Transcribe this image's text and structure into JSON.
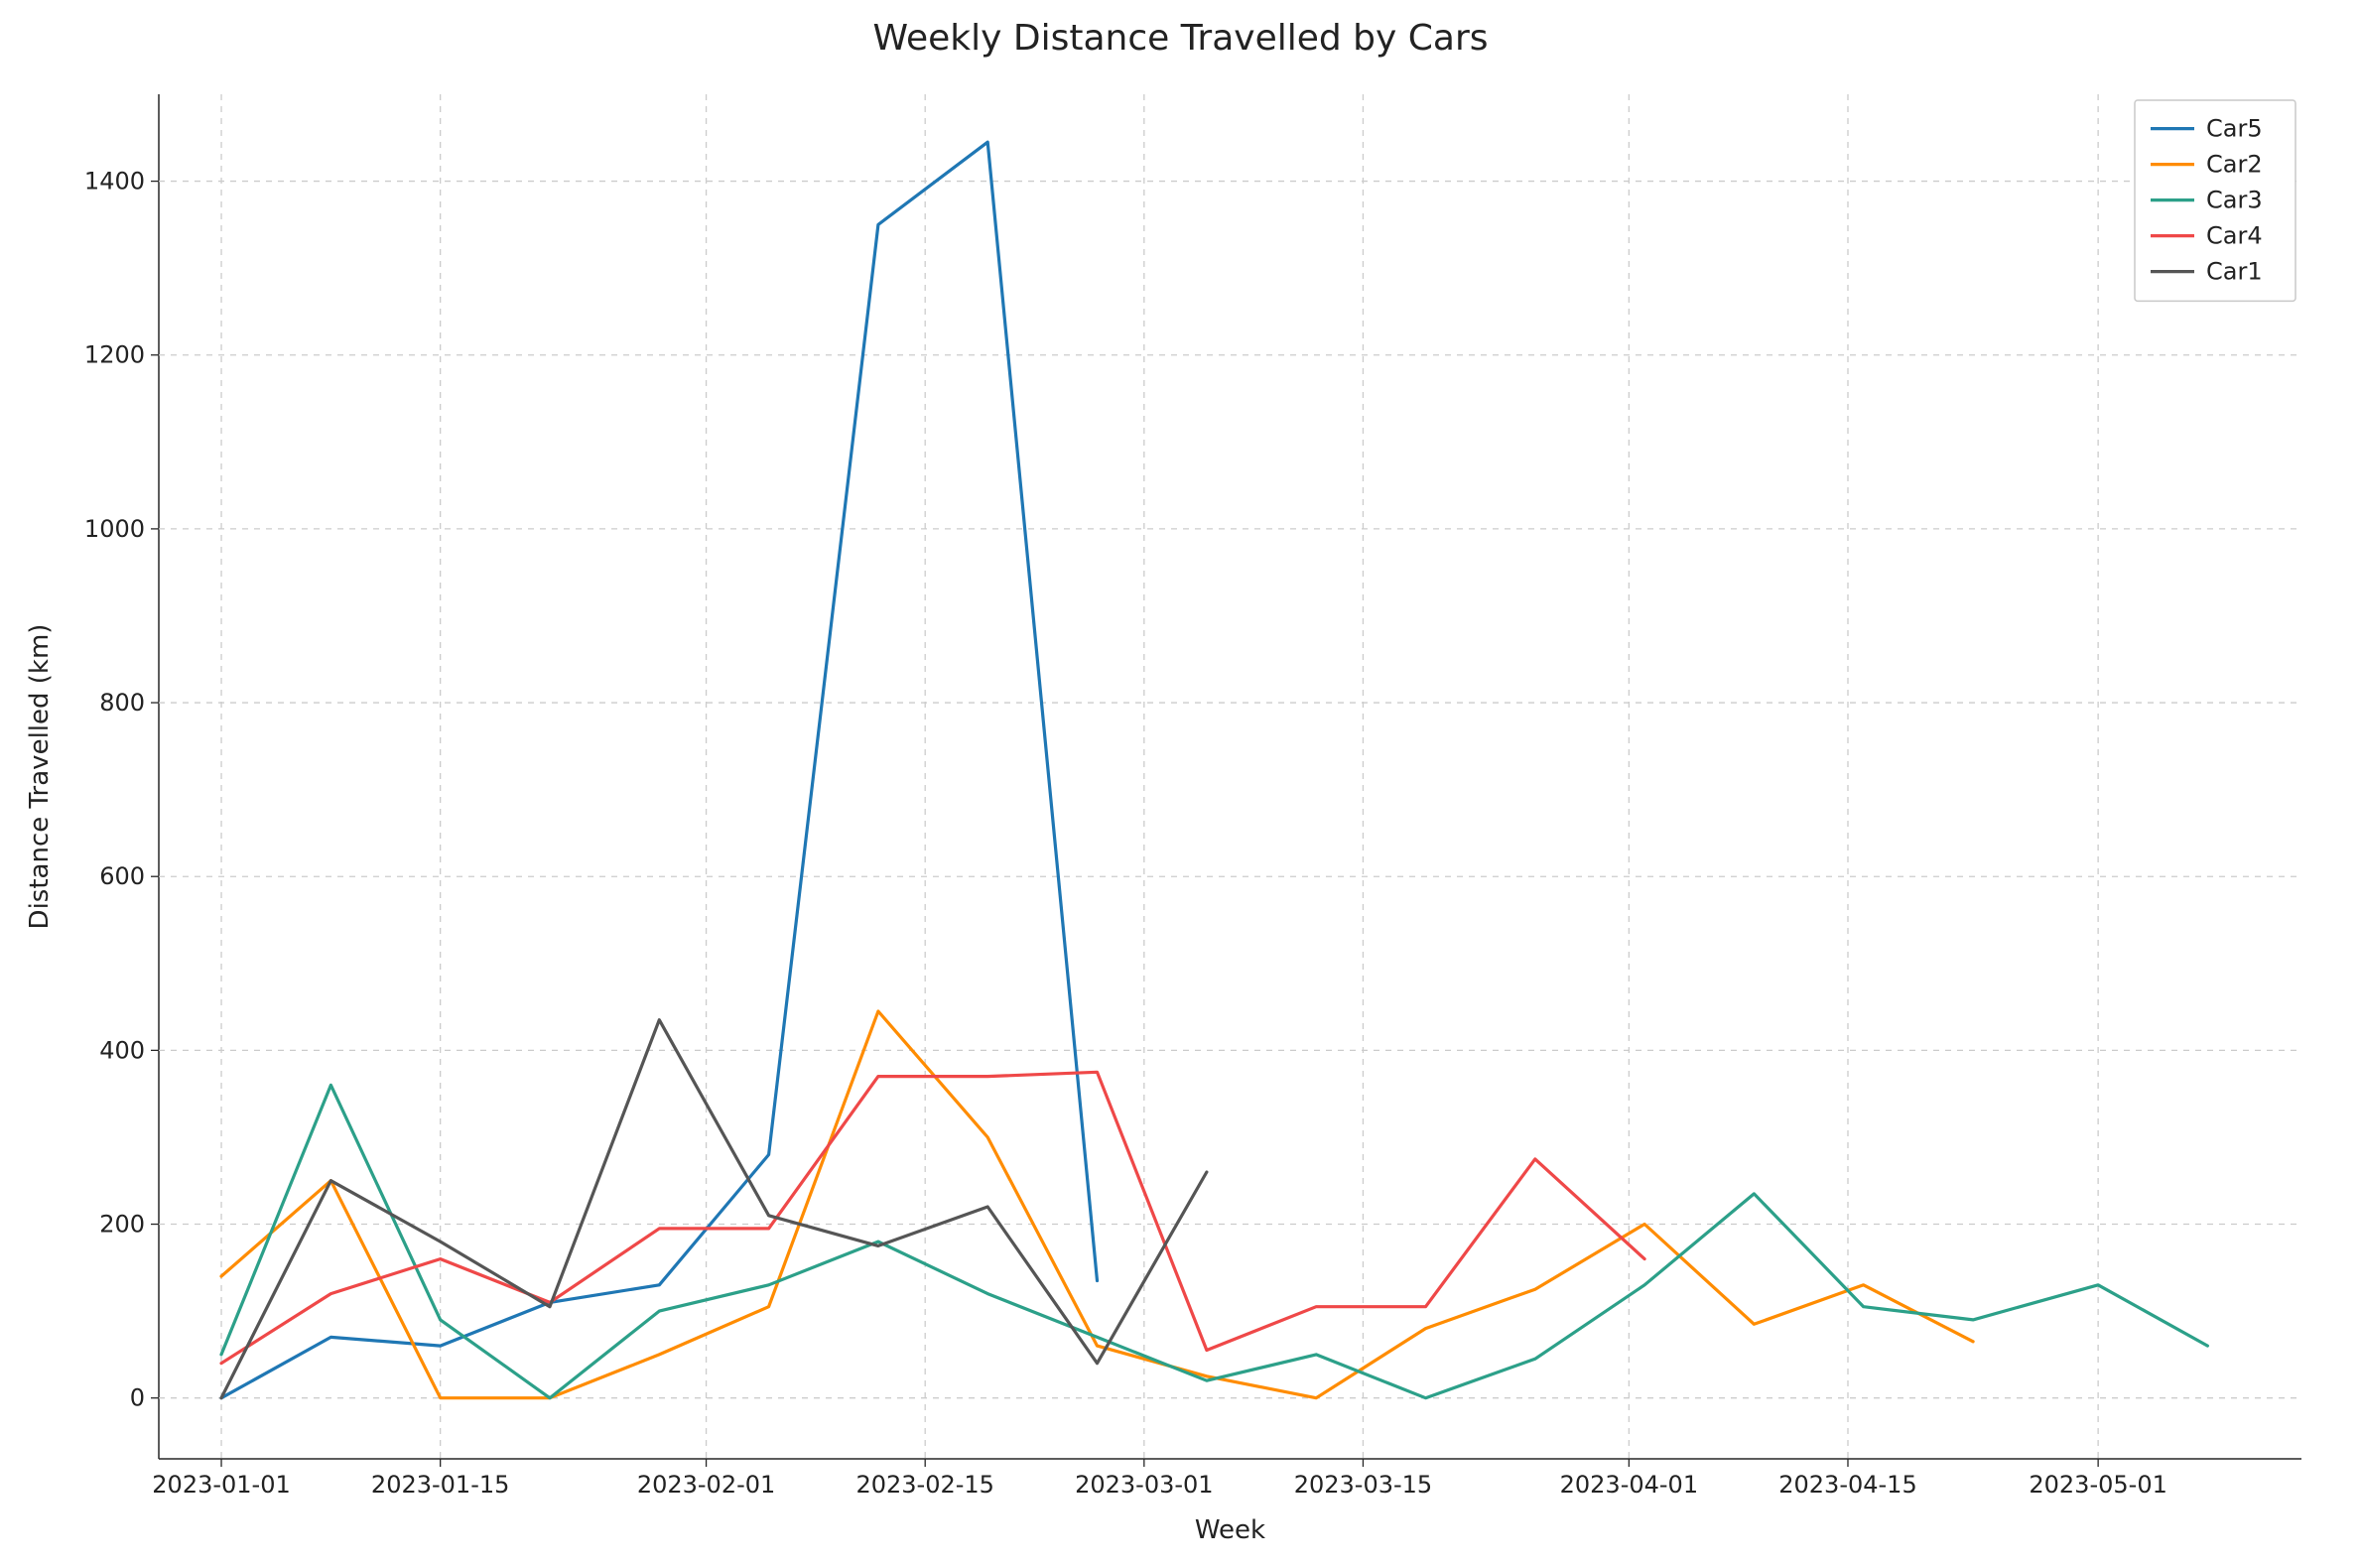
{
  "chart_data": {
    "type": "line",
    "title": "Weekly Distance Travelled by Cars",
    "xlabel": "Week",
    "ylabel": "Distance Travelled (km)",
    "x_ticks": [
      "2023-01-01",
      "2023-01-15",
      "2023-02-01",
      "2023-02-15",
      "2023-03-01",
      "2023-03-15",
      "2023-04-01",
      "2023-04-15",
      "2023-05-01"
    ],
    "y_ticks": [
      0,
      200,
      400,
      600,
      800,
      1000,
      1200,
      1400
    ],
    "xlim_days": [
      -4,
      133
    ],
    "ylim": [
      -70,
      1500
    ],
    "x_dates": [
      "2023-01-01",
      "2023-01-08",
      "2023-01-15",
      "2023-01-22",
      "2023-01-29",
      "2023-02-05",
      "2023-02-12",
      "2023-02-19",
      "2023-02-26",
      "2023-03-05",
      "2023-03-12",
      "2023-03-19",
      "2023-03-26",
      "2023-04-02",
      "2023-04-09",
      "2023-04-16",
      "2023-04-23",
      "2023-05-01",
      "2023-05-08"
    ],
    "series": [
      {
        "name": "Car5",
        "color": "#1f77b4",
        "values": [
          0,
          70,
          60,
          110,
          130,
          280,
          1350,
          1445,
          135,
          null,
          null,
          null,
          null,
          null,
          null,
          null,
          null,
          null,
          null
        ]
      },
      {
        "name": "Car2",
        "color": "#ff8c00",
        "values": [
          140,
          250,
          0,
          0,
          50,
          105,
          445,
          300,
          60,
          25,
          0,
          80,
          125,
          200,
          85,
          130,
          65,
          null,
          null
        ]
      },
      {
        "name": "Car3",
        "color": "#2ca089",
        "values": [
          50,
          360,
          90,
          0,
          100,
          130,
          180,
          120,
          70,
          20,
          50,
          0,
          45,
          130,
          235,
          105,
          90,
          130,
          60
        ]
      },
      {
        "name": "Car4",
        "color": "#ef4848",
        "values": [
          40,
          120,
          160,
          110,
          195,
          195,
          370,
          370,
          375,
          55,
          105,
          105,
          275,
          160,
          null,
          null,
          null,
          null,
          null
        ]
      },
      {
        "name": "Car1",
        "color": "#555555",
        "values": [
          0,
          250,
          180,
          105,
          435,
          210,
          175,
          220,
          40,
          260,
          null,
          null,
          null,
          null,
          null,
          null,
          null,
          null,
          null
        ]
      }
    ],
    "legend_order": [
      "Car5",
      "Car2",
      "Car3",
      "Car4",
      "Car1"
    ]
  }
}
